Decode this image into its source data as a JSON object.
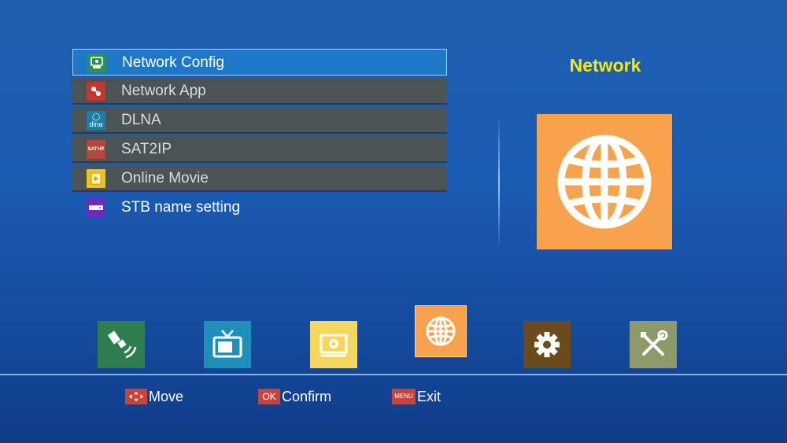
{
  "menu": {
    "items": [
      {
        "label": "Network Config",
        "icon": "network-config-icon",
        "color": "#2f8f5a"
      },
      {
        "label": "Network App",
        "icon": "network-app-icon",
        "color": "#c4372e"
      },
      {
        "label": "DLNA",
        "icon": "dlna-icon",
        "color": "#1b7fa5",
        "icon_text": "dlna"
      },
      {
        "label": "SAT2IP",
        "icon": "sat2ip-icon",
        "color": "#b2473d",
        "icon_text": "SAT>IP"
      },
      {
        "label": "Online Movie",
        "icon": "online-movie-icon",
        "color": "#f0c419"
      },
      {
        "label": "STB name setting",
        "icon": "stb-name-icon",
        "color": "#6a2cc0"
      }
    ],
    "selected_index": 0
  },
  "preview": {
    "title": "Network",
    "icon": "globe-icon",
    "color": "#f7a24c"
  },
  "dock": {
    "items": [
      {
        "icon": "satellite-icon",
        "color": "#2e7d4f"
      },
      {
        "icon": "tv-icon",
        "color": "#1e8fb8"
      },
      {
        "icon": "media-player-icon",
        "color": "#f4d75b"
      },
      {
        "icon": "globe-icon",
        "color": "#f7a24c"
      },
      {
        "icon": "gear-icon",
        "color": "#6b4a1c"
      },
      {
        "icon": "tools-icon",
        "color": "#8c9a6a"
      }
    ],
    "selected_index": 3
  },
  "hints": {
    "move_key": "",
    "move_label": "Move",
    "ok_key": "OK",
    "ok_label": "Confirm",
    "menu_key": "MENU",
    "menu_label": "Exit"
  }
}
